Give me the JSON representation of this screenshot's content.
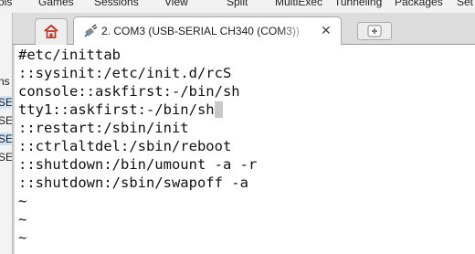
{
  "menubar": {
    "items": [
      "ols",
      "Games",
      "Sessions",
      "View",
      "Split",
      "MultiExec",
      "Tunneling",
      "Packages",
      "Set"
    ]
  },
  "sidebar": {
    "scraps": [
      "ns",
      "SE",
      "SE",
      "SE",
      "SE"
    ]
  },
  "tabs": {
    "home_icon": "home-icon",
    "session_icon": "plug-icon",
    "session_label": "2. COM3  (USB-SERIAL CH340 (COM3))",
    "close_glyph": "✕",
    "new_tab_icon": "plus-icon"
  },
  "terminal": {
    "lines": [
      "#etc/inittab",
      "::sysinit:/etc/init.d/rcS",
      "console::askfirst:-/bin/sh",
      "tty1::askfirst:-/bin/sh",
      "::restart:/sbin/init",
      "::ctrlaltdel:/sbin/reboot",
      "::shutdown:/bin/umount -a -r",
      "::shutdown:/sbin/swapoff -a",
      "~",
      "~",
      "~"
    ]
  },
  "colors": {
    "terminal_bg": "#ffffff",
    "terminal_fg": "#111111",
    "tab_active": "#ffffff",
    "chrome": "#dcdcdc"
  }
}
